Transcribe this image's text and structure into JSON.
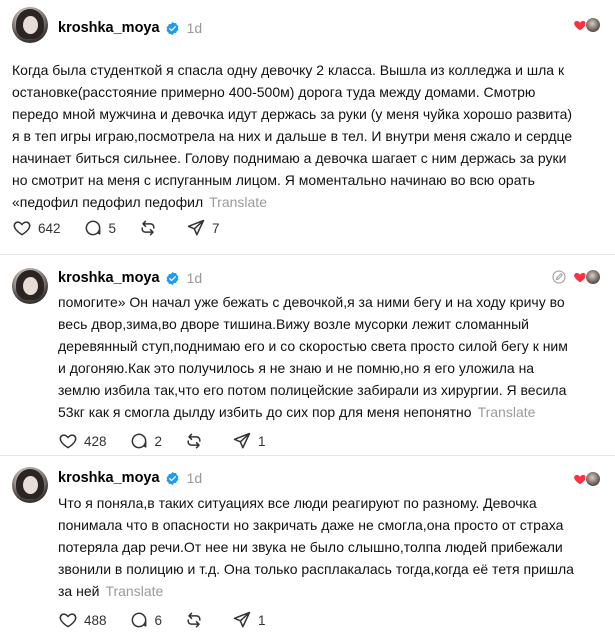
{
  "colors": {
    "verified": "#1d9bf0",
    "heart": "#ff3040",
    "muted": "#999999"
  },
  "icons": [
    "verified-badge-icon",
    "heart-icon",
    "comment-icon",
    "repost-icon",
    "share-icon",
    "edit-icon"
  ],
  "posts": [
    {
      "username": "kroshka_moya",
      "time": "1d",
      "lines": [
        "Когда была студенткой я спасла одну девочку 2 класса. Вышла из колледжа и шла к",
        "остановке(расстояние примерно 400-500м) дорога туда между домами. Смотрю",
        "передо мной мужчина и девочка идут держась за руки (у меня чуйка хорошо развита)",
        "я в теп игры играю,посмотрела на них и дальше в тел. И внутри меня сжало и сердце",
        "начинает биться сильнее. Голову поднимаю а девочка шагает с ним держась за руки",
        "но смотрит на меня с испуганным лицом. Я моментально начинаю во всю орать",
        "«педофил педофил педофил"
      ],
      "translate": "Translate",
      "likes": "642",
      "comments": "5",
      "shares": "7"
    },
    {
      "username": "kroshka_moya",
      "time": "1d",
      "lines": [
        "помогите» Он начал уже бежать с девочкой,я за ними бегу и на ходу кричу во",
        "весь двор,зима,во дворе тишина.Вижу возле мусорки лежит сломанный",
        "деревянный ступ,поднимаю его и со скоростью света просто силой бегу к ним",
        "и догоняю.Как это получилось я не знаю и не помню,но я его уложила на",
        "землю избила так,что его потом полицейские забирали из хирургии. Я весила",
        "53кг как я смогла дылду избить до сих пор для меня непонятно"
      ],
      "translate": "Translate",
      "likes": "428",
      "comments": "2",
      "shares": "1"
    },
    {
      "username": "kroshka_moya",
      "time": "1d",
      "lines": [
        "Что я поняла,в таких ситуациях все люди реагируют по разному. Девочка",
        "понимала что в опасности но закричать даже не смогла,она просто от страха",
        "потеряла дар речи.От нее ни звука не было слышно,толпа людей прибежали",
        "звонили в полицию и т.д. Она только расплакалась тогда,когда её тетя пришла",
        "за ней"
      ],
      "translate": "Translate",
      "likes": "488",
      "comments": "6",
      "shares": "1"
    }
  ]
}
